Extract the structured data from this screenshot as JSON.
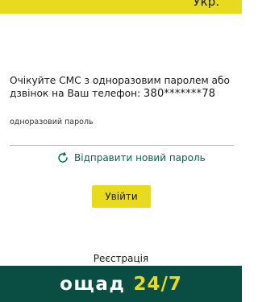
{
  "header": {
    "language": "Укр."
  },
  "otp": {
    "instruction": "Очікуйте СМС з одноразовим паролем або дзвінок на Ваш телефон:",
    "phone": "380*******78",
    "field_label": "одноразовий пароль",
    "field_value": "",
    "resend_label": "Відправити новий пароль",
    "submit_label": "Увійти"
  },
  "register_label": "Реєстрація",
  "footer": {
    "brand_name": "ощад",
    "brand_number": "24/7"
  },
  "colors": {
    "accent_yellow": "#e8da1e",
    "brand_green": "#0a4d43",
    "link_green": "#006a4e"
  },
  "icons": {
    "resend": "refresh-icon"
  }
}
